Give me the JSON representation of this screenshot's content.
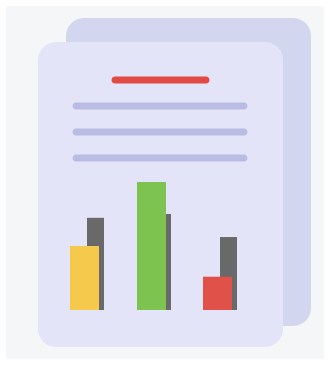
{
  "icon": {
    "name": "report-document-icon",
    "colors": {
      "background": "#f5f6f7",
      "back_sheet": "#d3d6ef",
      "front_sheet": "#e3e4f8",
      "title_line": "#e04a43",
      "text_lines": "#b9bde3",
      "bar_shadow": "#696969"
    },
    "chart_data": {
      "type": "bar",
      "categories": [
        "",
        "",
        ""
      ],
      "series": [
        {
          "values": [
            50,
            100,
            26
          ],
          "colors": [
            "#f5c94c",
            "#7cc44f",
            "#e05149"
          ]
        },
        {
          "values": [
            72,
            75,
            57
          ]
        }
      ]
    }
  }
}
